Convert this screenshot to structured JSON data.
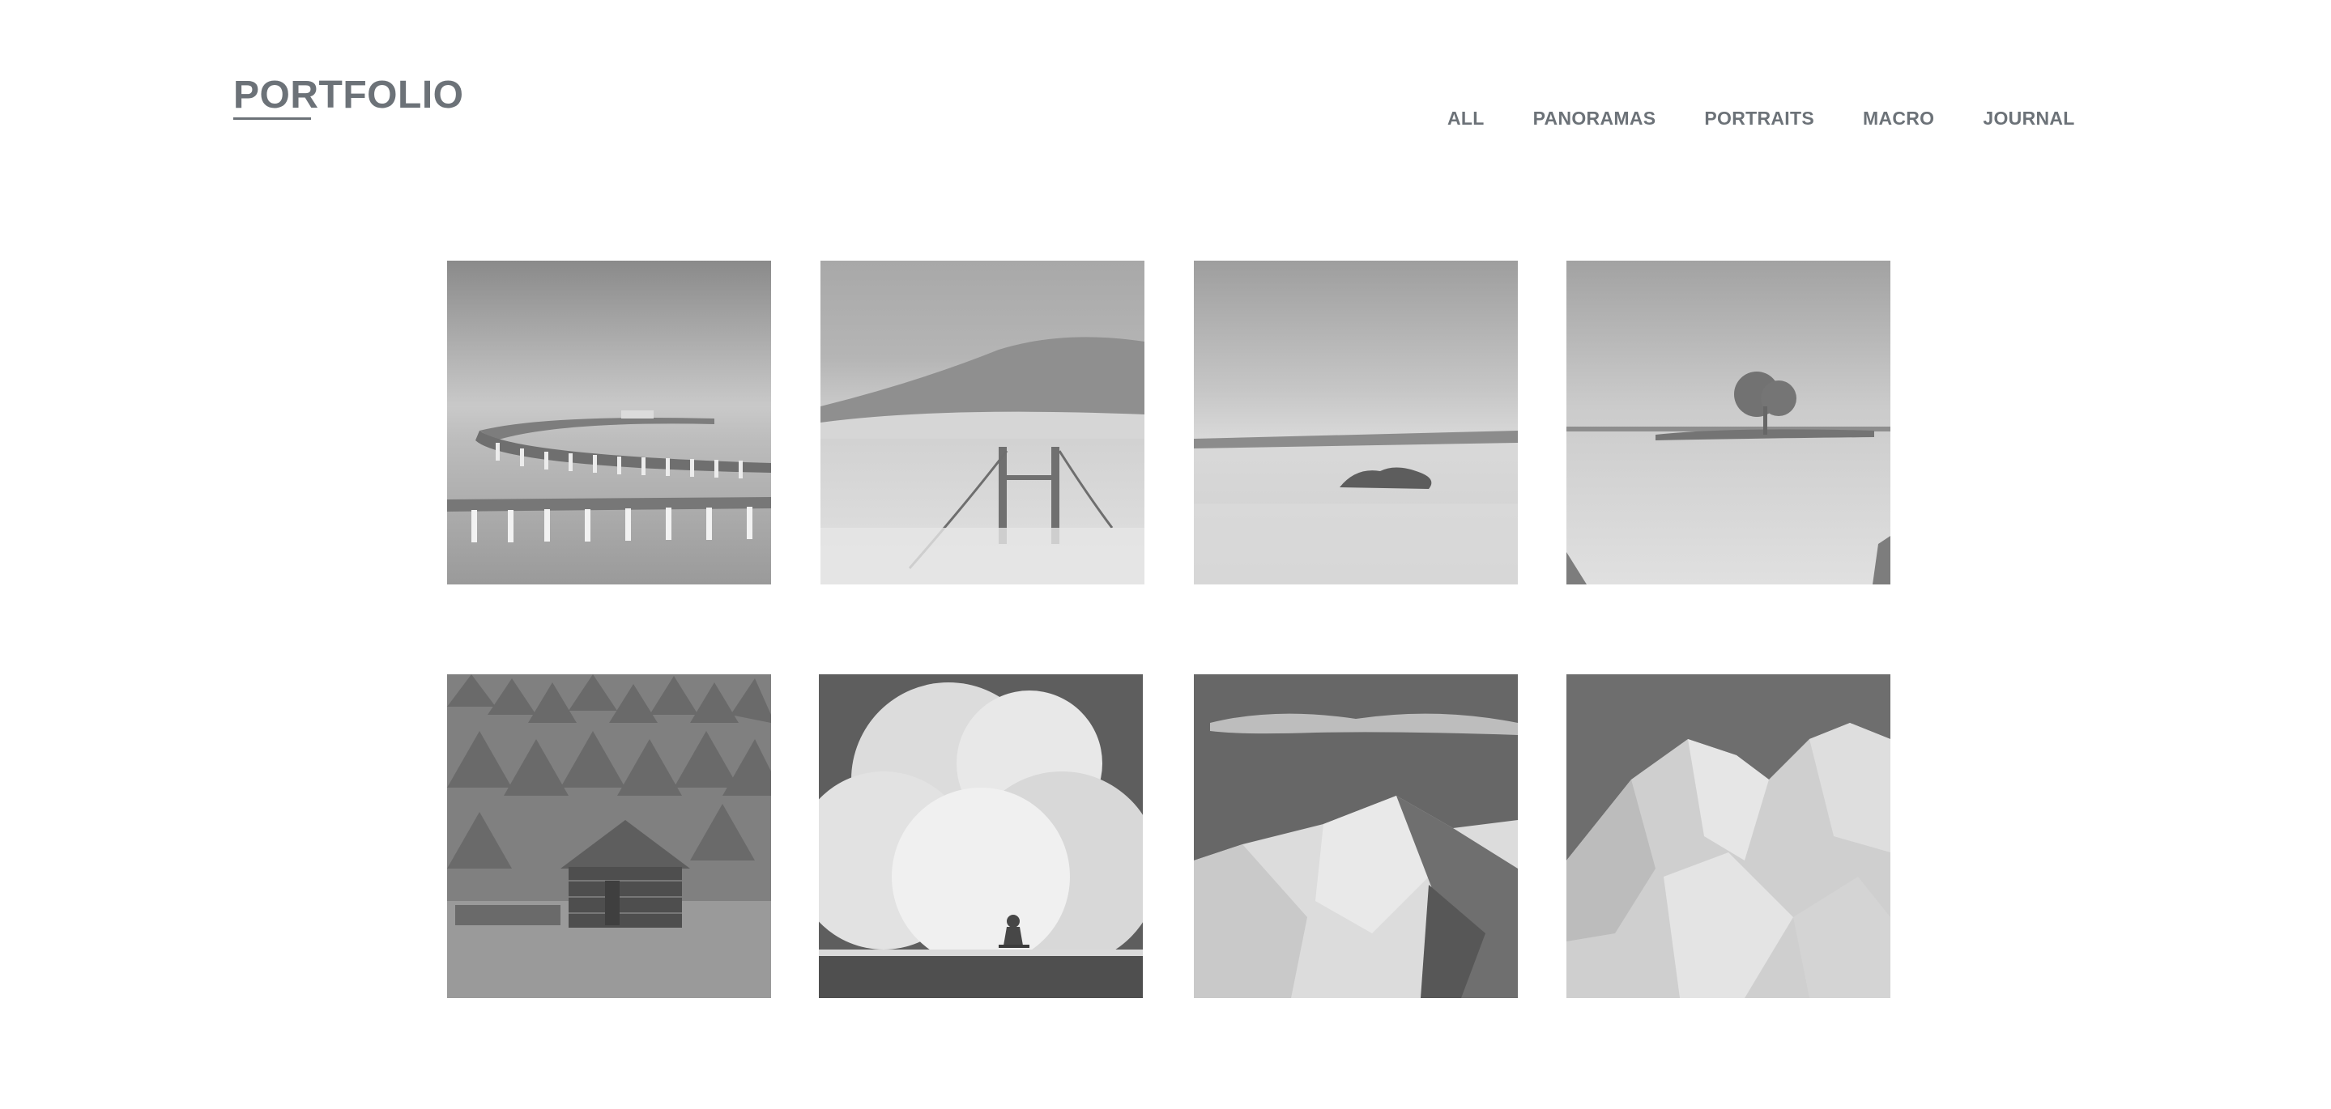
{
  "header": {
    "logo_text": "PORTFOLIO",
    "nav": [
      {
        "label": "ALL"
      },
      {
        "label": "PANORAMAS"
      },
      {
        "label": "PORTRAITS"
      },
      {
        "label": "MACRO"
      },
      {
        "label": "JOURNAL"
      }
    ]
  },
  "gallery": {
    "tiles": [
      {
        "subject": "pier-photo"
      },
      {
        "subject": "fog-bridge-photo"
      },
      {
        "subject": "rock-island-seascape-photo"
      },
      {
        "subject": "lone-tree-island-photo"
      },
      {
        "subject": "forest-cabin-photo"
      },
      {
        "subject": "wave-surfer-photo"
      },
      {
        "subject": "snowy-peak-photo"
      },
      {
        "subject": "snowy-ridge-photo"
      }
    ]
  },
  "colors": {
    "text": "#6c7278",
    "background": "#ffffff"
  }
}
